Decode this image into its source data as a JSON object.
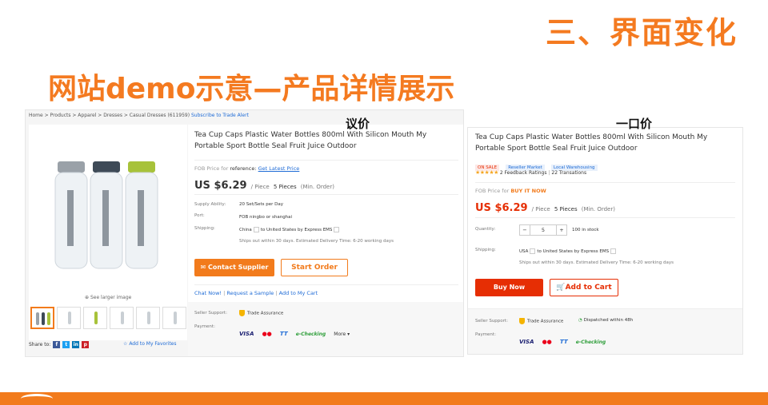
{
  "slide": {
    "section_title": "三、界面变化",
    "subtitle": "网站demo示意—产品详情展示",
    "label_negotiate": "议价",
    "label_fixed": "一口价"
  },
  "colors": {
    "accent": "#f27b1c",
    "red": "#e62e04",
    "link": "#1e6bd6"
  },
  "left_panel": {
    "breadcrumb": "Home > Products > Apparel > Dresses > Casual Dresses (611959)",
    "breadcrumb_alert": "Subscribe to Trade Alert",
    "see_larger": "See larger image",
    "share_label": "Share to:",
    "add_favorites": "Add to My Favorites",
    "product_title": "Tea Cup Caps Plastic Water Bottles 800ml With Silicon Mouth My Portable Sport Bottle Seal Fruit Juice Outdoor",
    "fob_label": "FOB Price for",
    "fob_reference": "reference:",
    "fob_link": "Get Latest Price",
    "price": "US $6.29",
    "price_unit": "/ Piece",
    "min_order": "5 Pieces",
    "min_order_note": "(Min. Order)",
    "supply_key": "Supply Ability:",
    "supply_val": "20 Set/Sets per Day",
    "port_key": "Port:",
    "port_val": "FOB ningbo or shanghai",
    "shipping_key": "Shipping:",
    "ship_from": "China",
    "ship_to": "to United States by Express EMS",
    "ship_note": "Ships out within 30 days. Estimated Delivery Time: 6-20 working days",
    "contact_btn": "Contact Supplier",
    "start_order_btn": "Start Order",
    "chat": "Chat Now!",
    "request_sample": "Request a Sample",
    "add_cart": "Add to My Cart",
    "seller_support": "Seller Support:",
    "trade_assurance": "Trade Assurance",
    "payment": "Payment:",
    "pay_visa": "VISA",
    "pay_mc": "●●",
    "pay_tt": "TT",
    "pay_echecking": "e-Checking",
    "pay_more": "More ▾"
  },
  "right_panel": {
    "product_title": "Tea Cup Caps Plastic Water Bottles 800ml With Silicon Mouth My Portable Sport Bottle Seal Fruit Juice Outdoor",
    "badge_sale": "ON SALE",
    "badge_reseller": "Reseller Market",
    "badge_warehouse": "Local Warehousing",
    "stars": "★★★★★",
    "feedback": "2 Feedback Ratings",
    "transactions": "22 Transations",
    "rating": 5,
    "fob_label": "FOB Price for",
    "buy_it_now": "BUY IT NOW",
    "price": "US $6.29",
    "price_unit": "/ Piece",
    "min_order": "5 Pieces",
    "min_order_note": "(Min. Order)",
    "quantity_key": "Quantity:",
    "qty_minus": "−",
    "qty_value": "5",
    "qty_plus": "+",
    "stock": "100 in stock",
    "shipping_key": "Shipping:",
    "ship_from": "USA",
    "ship_to": "to United States by Express EMS",
    "ship_note": "Ships out within 30 days. Estimated Delivery Time: 6-20 working days",
    "buy_now_btn": "Buy Now",
    "add_cart_btn": "Add to Cart",
    "seller_support": "Seller Support:",
    "trade_assurance": "Trade Assurance",
    "dispatched": "Dispatched within 48h",
    "payment": "Payment:",
    "pay_visa": "VISA",
    "pay_mc": "●●",
    "pay_tt": "TT",
    "pay_echecking": "e-Checking"
  },
  "icons": [
    "mail-icon",
    "search-icon",
    "cart-icon",
    "star-icon",
    "shield-icon",
    "clock-icon",
    "facebook-icon",
    "twitter-icon",
    "linkedin-icon",
    "pinterest-icon"
  ]
}
